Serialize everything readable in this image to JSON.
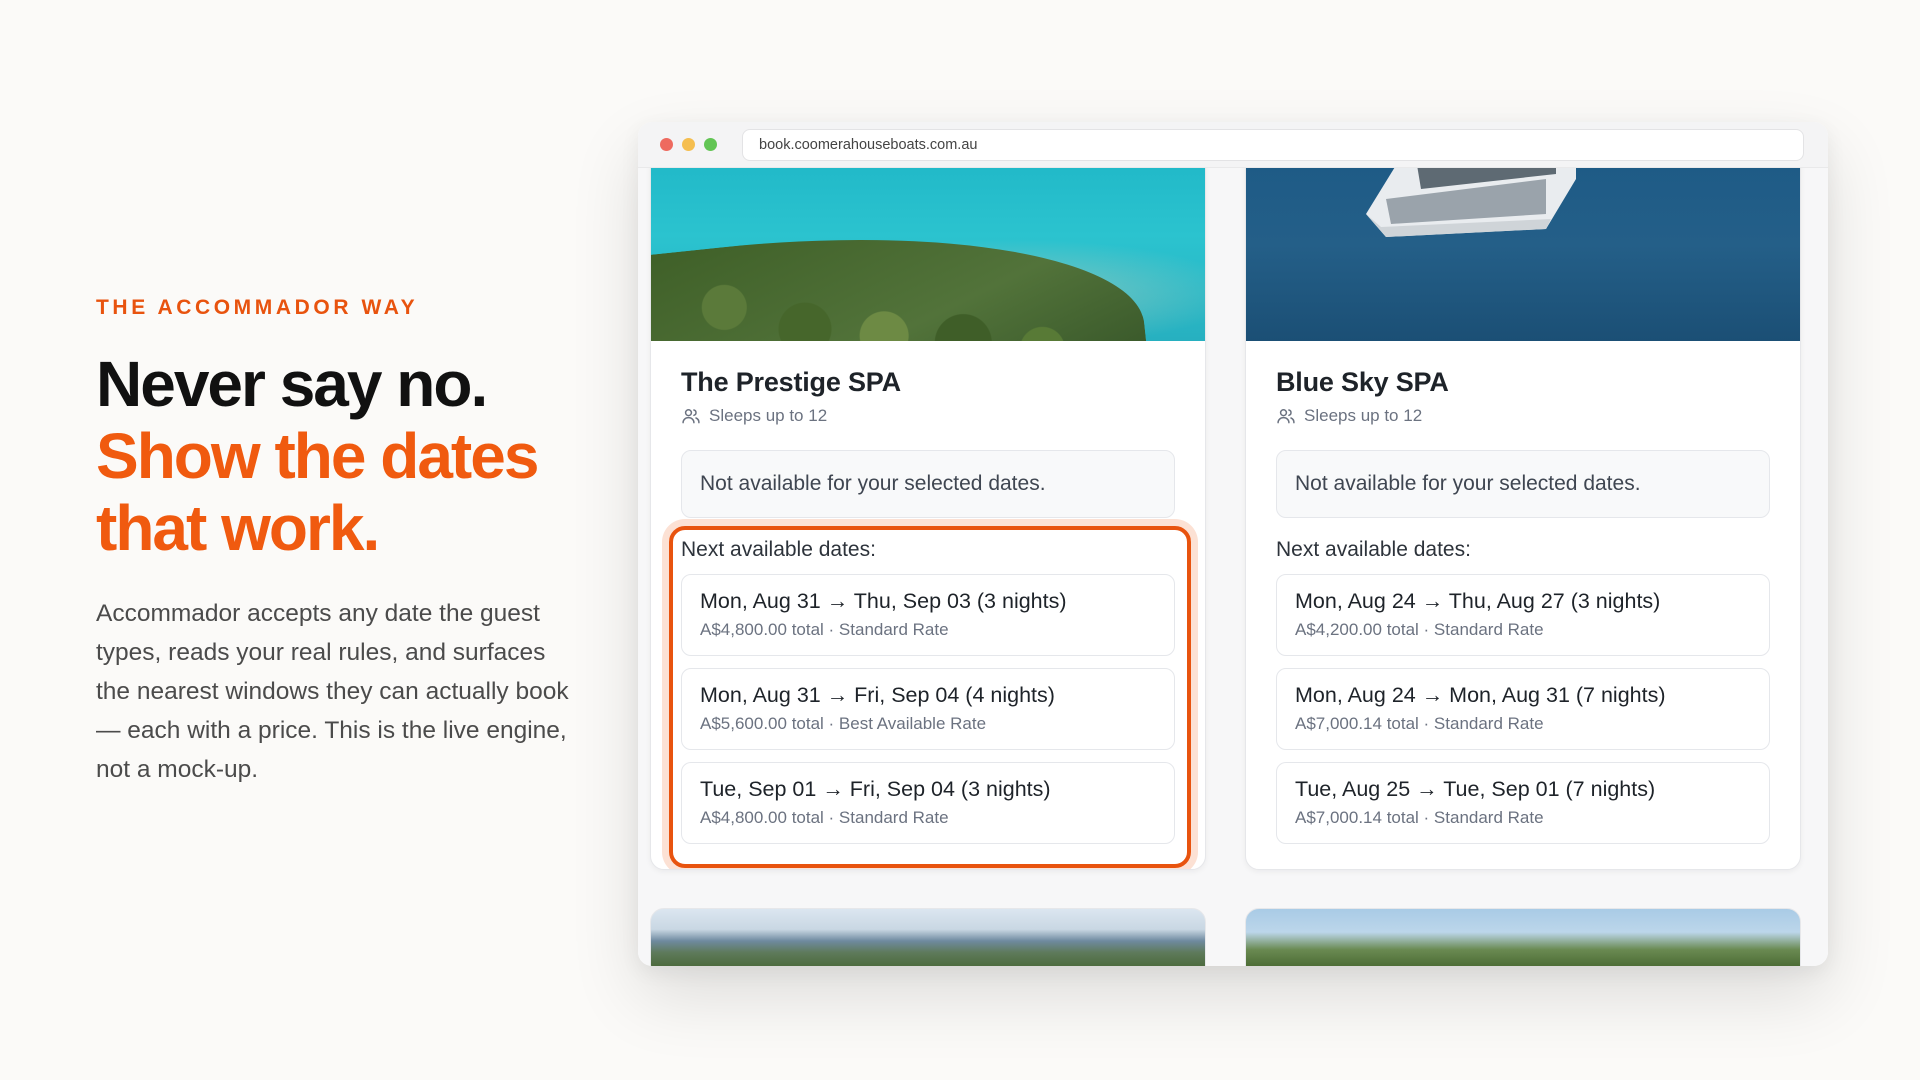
{
  "copy": {
    "eyebrow": "THE ACCOMMADOR WAY",
    "headline_line1": "Never say no.",
    "headline_line2": "Show the dates",
    "headline_line3": "that work.",
    "body": "Accommador accepts any date the guest types, reads your real rules, and surfaces the nearest windows they can actually book — each with a price. This is the live engine, not a mock-up."
  },
  "browser": {
    "url": "book.coomerahouseboats.com.au"
  },
  "colors": {
    "accent": "#f05a0f",
    "eyebrow": "#e8530e",
    "highlight_border": "#e8530e"
  },
  "cards": [
    {
      "title": "The Prestige SPA",
      "sleeps": "Sleeps up to 12",
      "notice": "Not available for your selected dates.",
      "next_label": "Next available dates:",
      "highlighted": true,
      "slots": [
        {
          "range": "Mon, Aug 31 → Thu, Sep 03 (3 nights)",
          "meta": "A$4,800.00 total · Standard Rate"
        },
        {
          "range": "Mon, Aug 31 → Fri, Sep 04 (4 nights)",
          "meta": "A$5,600.00 total · Best Available Rate"
        },
        {
          "range": "Tue, Sep 01 → Fri, Sep 04 (3 nights)",
          "meta": "A$4,800.00 total · Standard Rate"
        }
      ]
    },
    {
      "title": "Blue Sky SPA",
      "sleeps": "Sleeps up to 12",
      "notice": "Not available for your selected dates.",
      "next_label": "Next available dates:",
      "highlighted": false,
      "slots": [
        {
          "range": "Mon, Aug 24 → Thu, Aug 27 (3 nights)",
          "meta": "A$4,200.00 total · Standard Rate"
        },
        {
          "range": "Mon, Aug 24 → Mon, Aug 31 (7 nights)",
          "meta": "A$7,000.14 total · Standard Rate"
        },
        {
          "range": "Tue, Aug 25 → Tue, Sep 01 (7 nights)",
          "meta": "A$7,000.14 total · Standard Rate"
        }
      ]
    }
  ]
}
